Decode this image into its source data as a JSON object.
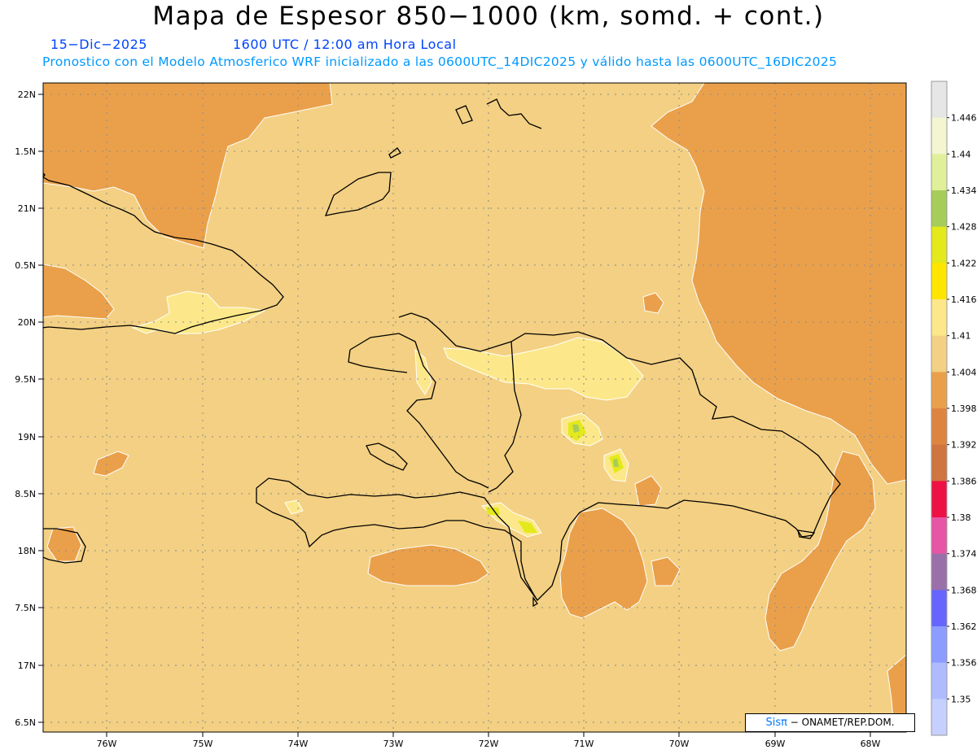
{
  "header": {
    "title": "Mapa de Espesor 850−1000 (km, somd. + cont.)",
    "date": "15−Dic−2025",
    "time": "1600 UTC / 12:00 am Hora Local",
    "forecast": "Pronostico con el Modelo Atmosferico WRF inicializado a las 0600UTC_14DIC2025 y válido hasta las  0600UTC_16DIC2025"
  },
  "axes": {
    "lat_labels": [
      "22N",
      "1.5N",
      "21N",
      "0.5N",
      "20N",
      "9.5N",
      "19N",
      "8.5N",
      "18N",
      "7.5N",
      "17N",
      "6.5N"
    ],
    "lon_labels": [
      "76W",
      "75W",
      "74W",
      "73W",
      "72W",
      "71W",
      "70W",
      "69W",
      "68W"
    ]
  },
  "colorbar": {
    "labels": [
      "1.446",
      "1.44",
      "1.434",
      "1.428",
      "1.422",
      "1.416",
      "1.41",
      "1.404",
      "1.398",
      "1.392",
      "1.386",
      "1.38",
      "1.374",
      "1.368",
      "1.362",
      "1.356",
      "1.35"
    ],
    "colors": [
      "#e6e6e6",
      "#f3f6d0",
      "#e0f09a",
      "#a6cc5a",
      "#e3e91a",
      "#ffe600",
      "#fce88a",
      "#f3d083",
      "#eaa04a",
      "#dd8540",
      "#cf7540",
      "#ee1144",
      "#e755a5",
      "#9a70aa",
      "#6666ff",
      "#8c9cff",
      "#aebcff",
      "#c6d0ff"
    ]
  },
  "map": {
    "fill_colors": {
      "background": "#f3d083",
      "low": "#eaa04a",
      "high": "#fce88a",
      "higher": "#e3e91a",
      "peak": "#a6cc5a"
    }
  },
  "credit": {
    "brand": "Sisπ",
    "text": " − ONAMET/REP.DOM."
  }
}
